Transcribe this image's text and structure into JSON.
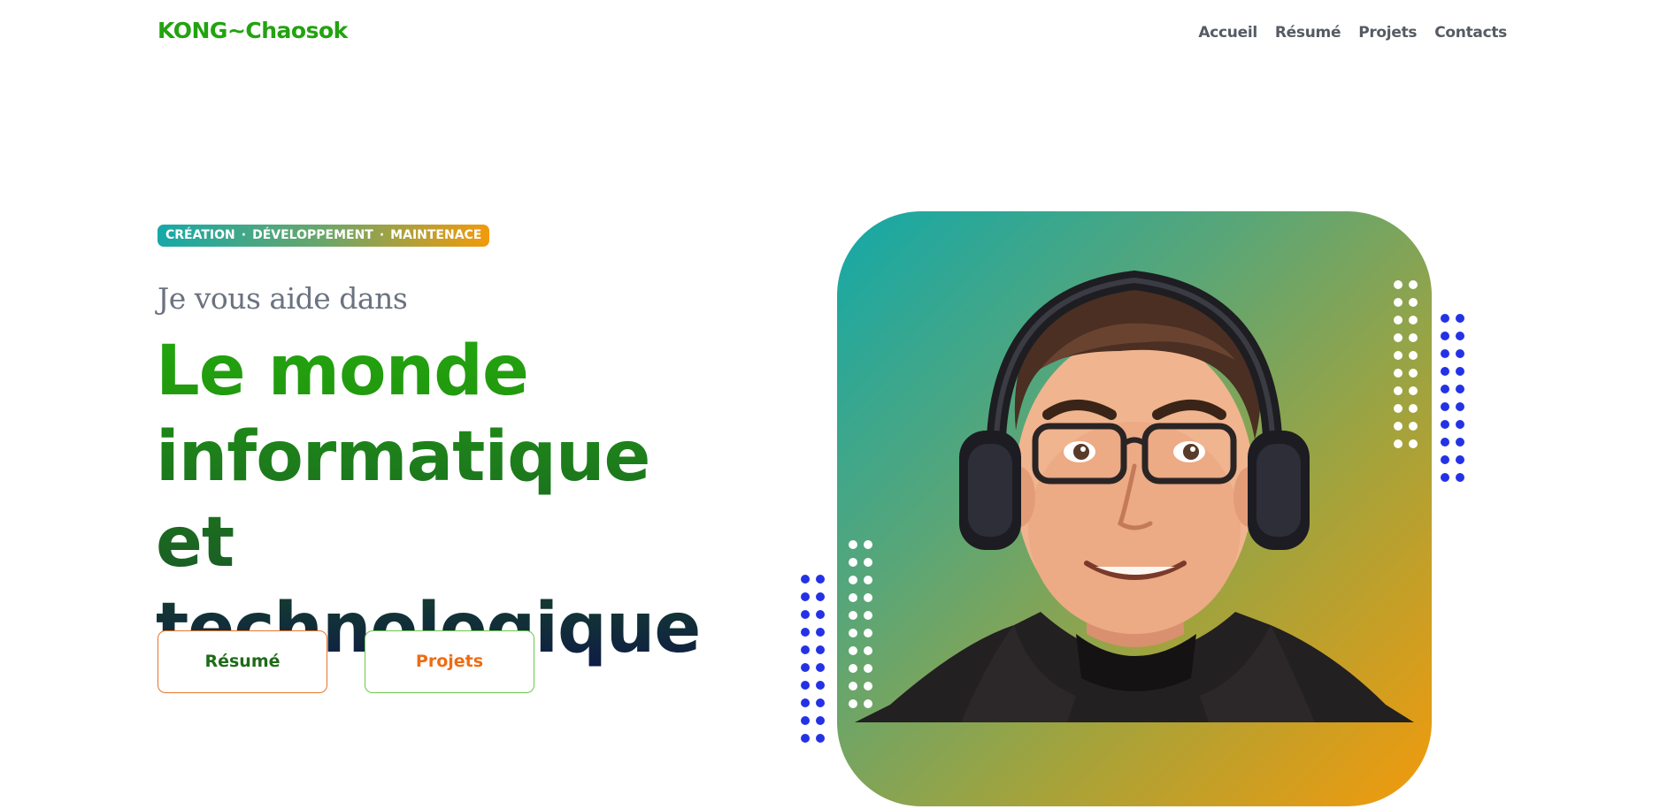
{
  "nav": {
    "brand": "KONG~Chaosok",
    "links": [
      {
        "label": "Accueil"
      },
      {
        "label": "Résumé"
      },
      {
        "label": "Projets"
      },
      {
        "label": "Contacts"
      }
    ]
  },
  "hero": {
    "badge": {
      "items": [
        "CRÉATION",
        "DÉVELOPPEMENT",
        "MAINTENACE"
      ],
      "separator": "·"
    },
    "intro": "Je vous aide dans",
    "headline": {
      "line1": "Le monde",
      "line2": "informatique et",
      "line3": "technologique"
    },
    "buttons": {
      "resume": "Résumé",
      "projets": "Projets"
    }
  },
  "colors": {
    "brand_green": "#22a30f",
    "accent_orange": "#f29a0c",
    "accent_teal": "#14a8a8",
    "dot_blue": "#2432e6",
    "dot_white": "#ffffff"
  },
  "image": {
    "avatar_icon": "cartoon-avatar-with-headphones"
  }
}
